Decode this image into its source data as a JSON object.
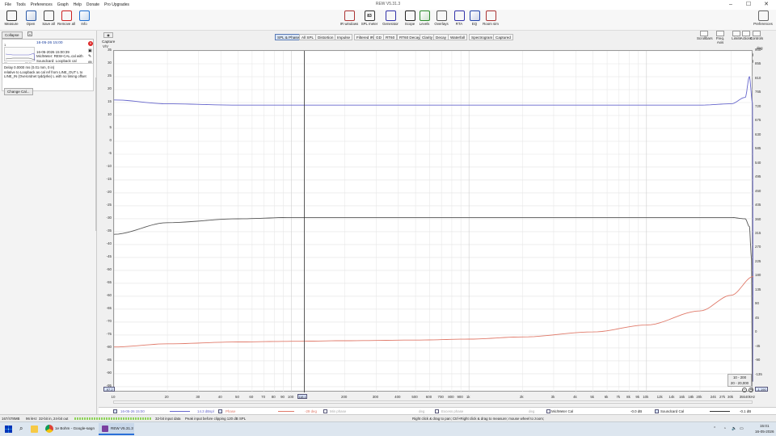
{
  "window": {
    "title": "REW V5.31.3",
    "minimize": "–",
    "maximize": "☐",
    "close": "✕"
  },
  "menu": [
    "File",
    "Tools",
    "Preferences",
    "Graph",
    "Help",
    "Donate",
    "Pro Upgrades"
  ],
  "toolbar_left": [
    {
      "label": "Measure",
      "icon": "measure-icon"
    },
    {
      "label": "Open",
      "icon": "folder-icon"
    },
    {
      "label": "Save all",
      "icon": "save-icon"
    },
    {
      "label": "Remove all",
      "icon": "remove-icon"
    },
    {
      "label": "Info",
      "icon": "info-icon"
    }
  ],
  "toolbar_center": [
    {
      "label": "IR windows",
      "icon": "ir-windows-icon"
    },
    {
      "label": "SPL meter",
      "icon": "spl-meter-icon",
      "badge": "83"
    },
    {
      "label": "Generator",
      "icon": "generator-icon"
    },
    {
      "label": "Scope",
      "icon": "scope-icon"
    },
    {
      "label": "Levels",
      "icon": "levels-icon"
    },
    {
      "label": "Overlays",
      "icon": "overlays-icon"
    },
    {
      "label": "RTA",
      "icon": "rta-icon"
    },
    {
      "label": "EQ",
      "icon": "eq-icon"
    },
    {
      "label": "Room sim",
      "icon": "room-sim-icon"
    }
  ],
  "toolbar_right": {
    "label": "Preferences",
    "icon": "wrench-icon"
  },
  "left_panel": {
    "collapse": "Collapse",
    "measurement_name": "16-05-26 15:00",
    "measurement_index": "1",
    "measurement_details": [
      "16-05-2026 15:00:39",
      "Mic/Meter: REW-CAL.cal with",
      "Soundcard: Loopback cal"
    ],
    "thumb_axis": [
      "20",
      "20.0k"
    ],
    "info_lines": [
      "Delay 0.0000 ms (0.01 mm, 0 in)",
      "relative to Loopback as cal ref from LINE_OUT L to",
      "LINE_IN (Overordnet tyddyrke) L with no timing offset"
    ],
    "change_cal": "Change Cal..."
  },
  "graph_tabs": [
    "SPL & Phase",
    "All SPL",
    "Distortion",
    "Impulse",
    "Filtered IR",
    "GD",
    "RT60",
    "RT60 Decay",
    "Clarity",
    "Decay",
    "Waterfall",
    "Spectrogram",
    "Captured"
  ],
  "selected_tab": "SPL & Phase",
  "capture": {
    "label": "Capture",
    "unit": "V/V"
  },
  "unit_selector": "V/V",
  "right_controls": [
    {
      "label": "Scrollbars",
      "icon": "scrollbars-icon"
    },
    {
      "label": "Freq. Axis",
      "icon": "freq-axis-icon"
    },
    {
      "label": "Limits",
      "icon": "limits-icon"
    },
    {
      "label": "Actions",
      "icon": "actions-icon"
    },
    {
      "label": "Controls",
      "icon": "controls-icon"
    }
  ],
  "right_axis_unit": "deg",
  "y_ticks": [
    "35",
    "30",
    "25",
    "20",
    "15",
    "10",
    "5",
    "0",
    "-5",
    "-10",
    "-15",
    "-20",
    "-25",
    "-30",
    "-35",
    "-40",
    "-45",
    "-50",
    "-55",
    "-60",
    "-65",
    "-70",
    "-75",
    "-80",
    "-85",
    "-90",
    "-95"
  ],
  "y_bottom_value": "-97.2",
  "r_ticks": [
    "900",
    "855",
    "810",
    "765",
    "720",
    "675",
    "630",
    "585",
    "540",
    "495",
    "450",
    "405",
    "360",
    "315",
    "270",
    "225",
    "180",
    "135",
    "90",
    "45",
    "0",
    "-45",
    "-90",
    "-135"
  ],
  "r_bottom_value": "-1.190",
  "x_ticks": [
    {
      "f": 10,
      "l": "10"
    },
    {
      "f": 20,
      "l": "20"
    },
    {
      "f": 30,
      "l": "30"
    },
    {
      "f": 40,
      "l": "40"
    },
    {
      "f": 50,
      "l": "50"
    },
    {
      "f": 60,
      "l": "60"
    },
    {
      "f": 70,
      "l": "70"
    },
    {
      "f": 80,
      "l": "80"
    },
    {
      "f": 90,
      "l": "90"
    },
    {
      "f": 100,
      "l": "100"
    },
    {
      "f": 200,
      "l": "200"
    },
    {
      "f": 300,
      "l": "300"
    },
    {
      "f": 400,
      "l": "400"
    },
    {
      "f": 500,
      "l": "500"
    },
    {
      "f": 600,
      "l": "600"
    },
    {
      "f": 700,
      "l": "700"
    },
    {
      "f": 800,
      "l": "800"
    },
    {
      "f": 900,
      "l": "900"
    },
    {
      "f": 1000,
      "l": "1k"
    },
    {
      "f": 2000,
      "l": "2k"
    },
    {
      "f": 3000,
      "l": "3k"
    },
    {
      "f": 4000,
      "l": "4k"
    },
    {
      "f": 5000,
      "l": "5k"
    },
    {
      "f": 6000,
      "l": "6k"
    },
    {
      "f": 7000,
      "l": "7k"
    },
    {
      "f": 8000,
      "l": "8k"
    },
    {
      "f": 9000,
      "l": "9k"
    },
    {
      "f": 10000,
      "l": "10k"
    },
    {
      "f": 12000,
      "l": "12k"
    },
    {
      "f": 14000,
      "l": "14k"
    },
    {
      "f": 16000,
      "l": "16k"
    },
    {
      "f": 18000,
      "l": "18k"
    },
    {
      "f": 20000,
      "l": "20k"
    },
    {
      "f": 24000,
      "l": "24k"
    },
    {
      "f": 27000,
      "l": "27k"
    },
    {
      "f": 30000,
      "l": "30k"
    },
    {
      "f": 35000,
      "l": "35k"
    },
    {
      "f": 40000,
      "l": "40kHz"
    }
  ],
  "cursor": {
    "freq_label": "118.1",
    "spl_label": "14.3 dBspl",
    "phase_label": "-29 deg"
  },
  "overlay_box": [
    "10 - 200",
    "20 - 20,000"
  ],
  "legend": {
    "trace": "16-05-26 15:00",
    "spl_value": "14.3 dBspl",
    "phase_name": "Phase",
    "phase_value": "-29 deg",
    "min_phase": "Min phase",
    "excess_phase": "Excess phase",
    "deg1": "deg",
    "deg2": "deg",
    "mic_cal": "Mic/Meter Cal",
    "mic_val": "-0.0 dB",
    "sound_cal": "Soundcard Cal",
    "sound_val": "-0.1 dB"
  },
  "status": {
    "mem": "167/478MB",
    "rate": "96 kHz",
    "bits": "32-bit in, 24-bit out",
    "depth": "32-bit input data",
    "peak": "Peak input before clipping 120 dB SPL",
    "hint": "Right click & drag to pan; Ctrl+Right click & drag to measure; mouse wheel to zoom;"
  },
  "taskbar": {
    "search": "1e Bohm - Google-søgn",
    "app": "REW V5.31.3",
    "time": "15:01",
    "date": "16-05-2026"
  },
  "colors": {
    "spl": "#6666cc",
    "phase": "#e07a6a",
    "distortion": "#555555",
    "accent": "#5a7ab5"
  },
  "chart_data": {
    "type": "line",
    "x_scale": "log",
    "xlim": [
      10,
      40000
    ],
    "ylim": [
      -97.2,
      35
    ],
    "ylim_right": [
      -190,
      900
    ],
    "series": [
      {
        "name": "16-05-26 15:00",
        "axis": "left",
        "color": "#6666cc",
        "x": [
          10,
          20,
          50,
          100,
          500,
          1000,
          5000,
          10000,
          20000,
          30000,
          36000,
          38000,
          39500,
          40000
        ],
        "y": [
          16,
          14.5,
          14,
          14,
          14,
          14,
          14,
          14,
          14,
          14.5,
          17,
          25,
          15,
          -93
        ]
      },
      {
        "name": "distortion",
        "axis": "left",
        "color": "#555555",
        "x": [
          10,
          20,
          50,
          100,
          500,
          1000,
          5000,
          10000,
          20000,
          30000,
          36000,
          38000,
          39000,
          39500
        ],
        "y": [
          -36,
          -31.5,
          -30,
          -29.5,
          -29.5,
          -29.5,
          -29.5,
          -29.5,
          -29.5,
          -29.5,
          -30,
          -33,
          -45,
          -93
        ]
      },
      {
        "name": "Phase",
        "axis": "right",
        "color": "#e07a6a",
        "x": [
          10,
          20,
          50,
          100,
          200,
          500,
          1000,
          2000,
          5000,
          10000,
          20000,
          30000,
          40000
        ],
        "y": [
          -45,
          -35,
          -29,
          -27,
          -25,
          -23,
          -20,
          -13,
          3,
          25,
          70,
          120,
          180
        ]
      }
    ]
  }
}
